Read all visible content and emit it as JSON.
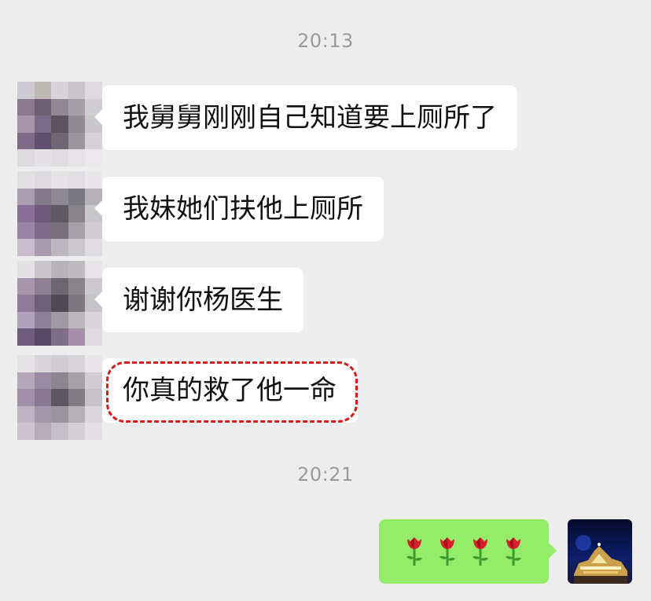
{
  "chat": {
    "timestamps": [
      "20:13",
      "20:21"
    ],
    "incoming_messages": [
      "我舅舅刚刚自己知道要上厕所了",
      "我妹她们扶他上厕所",
      "谢谢你杨医生",
      "你真的救了他一命"
    ],
    "outgoing_message": {
      "content": "4 rose emoji",
      "icons": [
        "rose-icon",
        "rose-icon",
        "rose-icon",
        "rose-icon"
      ]
    },
    "highlighted_message_index": 3
  },
  "colors": {
    "background": "#ededed",
    "incoming_bubble": "#ffffff",
    "outgoing_bubble": "#95ec69",
    "timestamp_text": "#9a9a9a",
    "highlight_border": "#d71a1a"
  }
}
